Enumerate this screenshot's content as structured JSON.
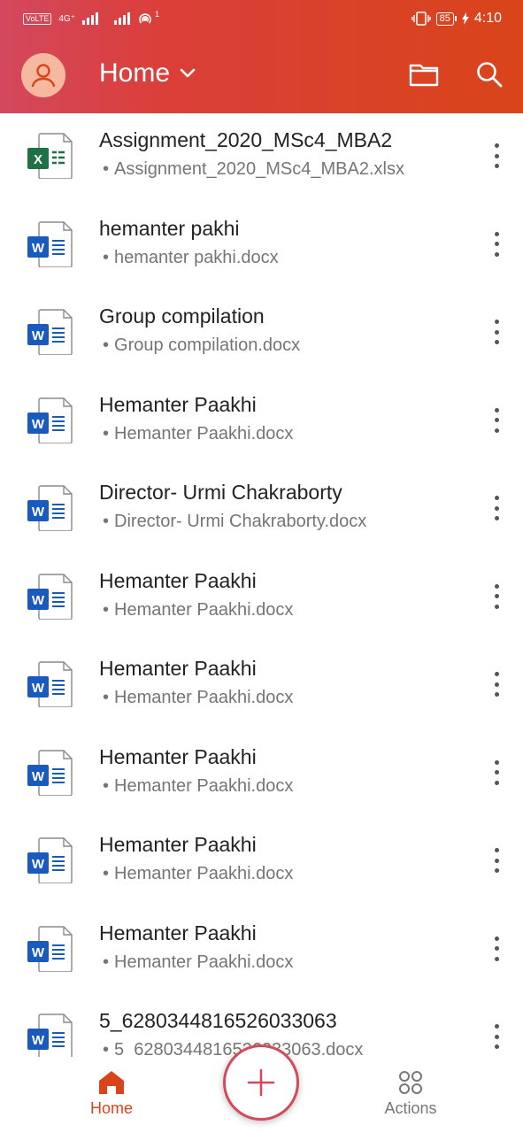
{
  "status_bar": {
    "volte": "VoLTE",
    "network": "4G⁺",
    "hotspot_count": "1",
    "battery": "85",
    "time": "4:10"
  },
  "header": {
    "title": "Home",
    "icons": [
      "user-avatar-icon",
      "chevron-down-icon",
      "folder-icon",
      "search-icon"
    ]
  },
  "files": [
    {
      "name": "Assignment_2020_MSc4_MBA2",
      "sub": "Assignment_2020_MSc4_MBA2.xlsx",
      "type": "excel"
    },
    {
      "name": "hemanter pakhi",
      "sub": "hemanter pakhi.docx",
      "type": "word"
    },
    {
      "name": "Group compilation",
      "sub": "Group compilation.docx",
      "type": "word"
    },
    {
      "name": "Hemanter Paakhi",
      "sub": "Hemanter Paakhi.docx",
      "type": "word"
    },
    {
      "name": "Director- Urmi Chakraborty",
      "sub": "Director- Urmi Chakraborty.docx",
      "type": "word"
    },
    {
      "name": "Hemanter Paakhi",
      "sub": "Hemanter Paakhi.docx",
      "type": "word"
    },
    {
      "name": "Hemanter Paakhi",
      "sub": "Hemanter Paakhi.docx",
      "type": "word"
    },
    {
      "name": "Hemanter Paakhi",
      "sub": "Hemanter Paakhi.docx",
      "type": "word"
    },
    {
      "name": "Hemanter Paakhi",
      "sub": "Hemanter Paakhi.docx",
      "type": "word"
    },
    {
      "name": "Hemanter Paakhi",
      "sub": "Hemanter Paakhi.docx",
      "type": "word"
    },
    {
      "name": "5_6280344816526033063",
      "sub": "5_6280344816526033063.docx",
      "type": "word"
    }
  ],
  "bottom_nav": {
    "home_label": "Home",
    "actions_label": "Actions",
    "add_icon": "plus-icon"
  },
  "colors": {
    "header_start": "#d3485e",
    "header_end": "#d9441a",
    "accent": "#d9441a",
    "excel": "#1e7145",
    "word": "#185abd",
    "inactive": "#777777"
  }
}
